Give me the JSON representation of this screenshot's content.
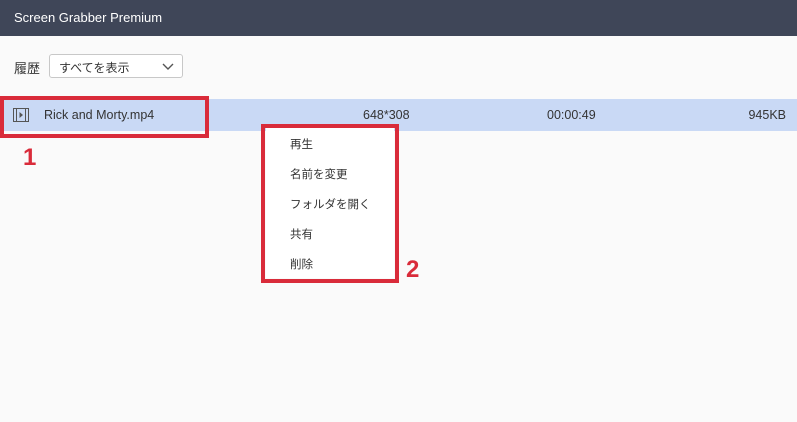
{
  "app": {
    "title": "Screen Grabber Premium"
  },
  "filter": {
    "label": "履歴",
    "selected": "すべてを表示"
  },
  "recording": {
    "name": "Rick and Morty.mp4",
    "resolution": "648*308",
    "duration": "00:00:49",
    "size": "945KB"
  },
  "context_menu": {
    "items": [
      "再生",
      "名前を変更",
      "フォルダを開く",
      "共有",
      "削除"
    ]
  },
  "annotations": {
    "step1": "1",
    "step2": "2",
    "highlight_color": "#d92b3a"
  },
  "colors": {
    "titlebar": "#3f4658",
    "selected_row": "#c9d9f5"
  }
}
